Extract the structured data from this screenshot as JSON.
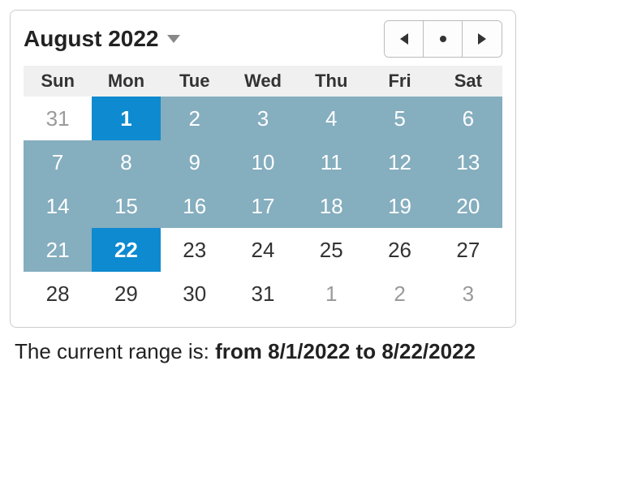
{
  "header": {
    "month_label": "August 2022"
  },
  "weekdays": [
    "Sun",
    "Mon",
    "Tue",
    "Wed",
    "Thu",
    "Fri",
    "Sat"
  ],
  "weeks": [
    [
      {
        "n": "31",
        "state": "outside"
      },
      {
        "n": "1",
        "state": "endpoint"
      },
      {
        "n": "2",
        "state": "in-range"
      },
      {
        "n": "3",
        "state": "in-range"
      },
      {
        "n": "4",
        "state": "in-range"
      },
      {
        "n": "5",
        "state": "in-range"
      },
      {
        "n": "6",
        "state": "in-range"
      }
    ],
    [
      {
        "n": "7",
        "state": "in-range"
      },
      {
        "n": "8",
        "state": "in-range"
      },
      {
        "n": "9",
        "state": "in-range"
      },
      {
        "n": "10",
        "state": "in-range"
      },
      {
        "n": "11",
        "state": "in-range"
      },
      {
        "n": "12",
        "state": "in-range"
      },
      {
        "n": "13",
        "state": "in-range"
      }
    ],
    [
      {
        "n": "14",
        "state": "in-range"
      },
      {
        "n": "15",
        "state": "in-range"
      },
      {
        "n": "16",
        "state": "in-range"
      },
      {
        "n": "17",
        "state": "in-range"
      },
      {
        "n": "18",
        "state": "in-range"
      },
      {
        "n": "19",
        "state": "in-range"
      },
      {
        "n": "20",
        "state": "in-range"
      }
    ],
    [
      {
        "n": "21",
        "state": "in-range"
      },
      {
        "n": "22",
        "state": "endpoint"
      },
      {
        "n": "23",
        "state": "normal"
      },
      {
        "n": "24",
        "state": "normal"
      },
      {
        "n": "25",
        "state": "normal"
      },
      {
        "n": "26",
        "state": "normal"
      },
      {
        "n": "27",
        "state": "normal"
      }
    ],
    [
      {
        "n": "28",
        "state": "normal"
      },
      {
        "n": "29",
        "state": "normal"
      },
      {
        "n": "30",
        "state": "normal"
      },
      {
        "n": "31",
        "state": "normal"
      },
      {
        "n": "1",
        "state": "outside"
      },
      {
        "n": "2",
        "state": "outside"
      },
      {
        "n": "3",
        "state": "outside"
      }
    ]
  ],
  "range_text": {
    "prefix": "The current range is: ",
    "value": "from 8/1/2022 to 8/22/2022"
  }
}
